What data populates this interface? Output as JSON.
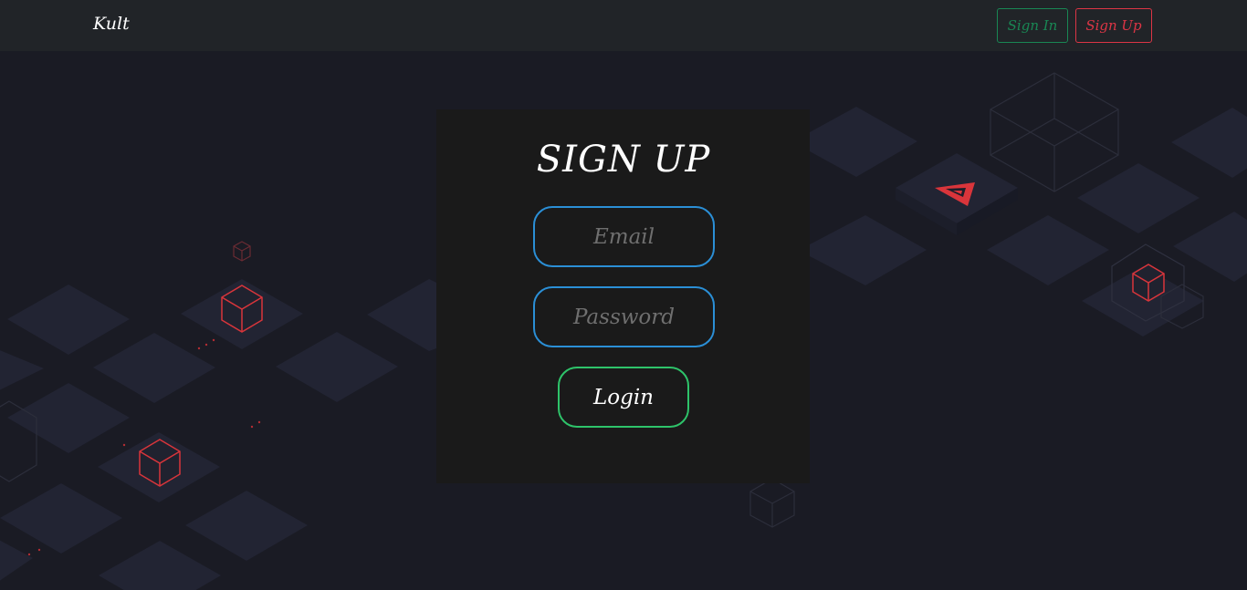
{
  "navbar": {
    "brand": "Kult",
    "sign_in_label": "Sign In",
    "sign_up_label": "Sign Up"
  },
  "form": {
    "title": "SIGN UP",
    "email_placeholder": "Email",
    "email_value": "",
    "password_placeholder": "Password",
    "password_value": "",
    "submit_label": "Login"
  },
  "colors": {
    "page_background": "#1a1b24",
    "navbar_background": "#212428",
    "card_background": "#1a1a1a",
    "input_border": "#2b8fd6",
    "submit_border": "#2ec36a",
    "sign_in_accent": "#198754",
    "sign_up_accent": "#dc3545",
    "tile": "#222433",
    "cube_accent": "#d9353b"
  },
  "icons": [
    "cube-icon",
    "arrow-logo-icon"
  ]
}
